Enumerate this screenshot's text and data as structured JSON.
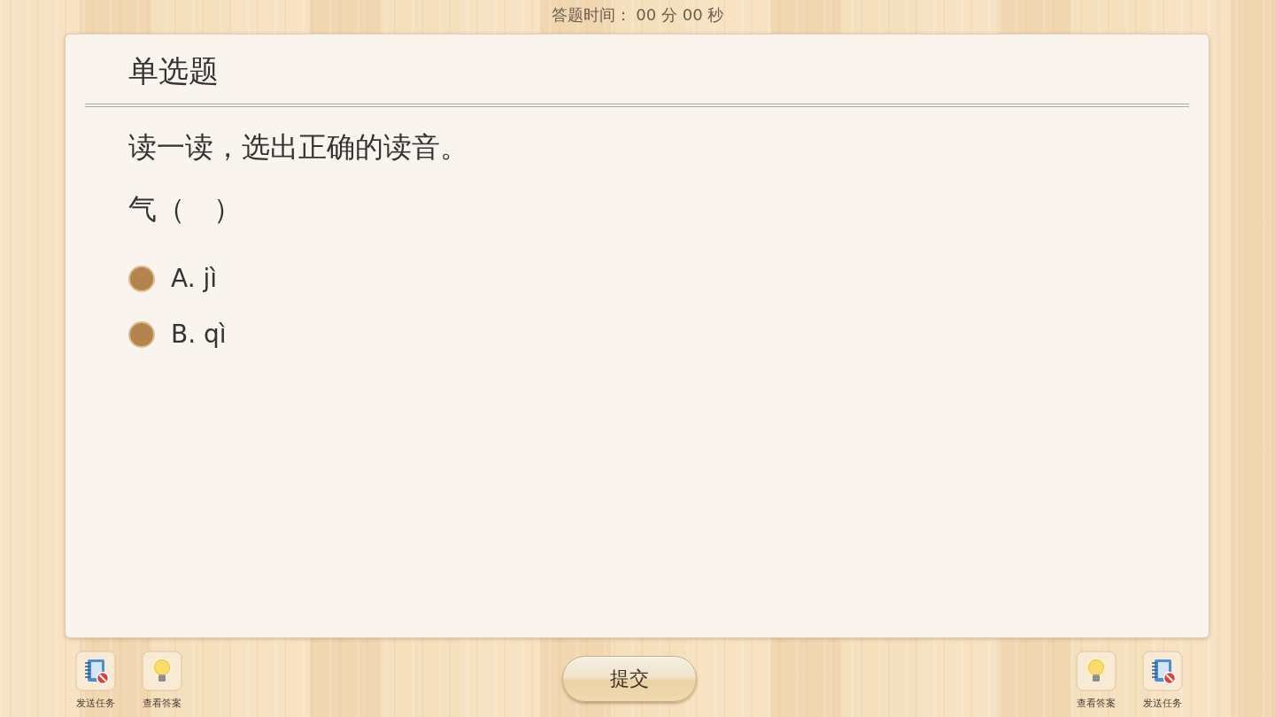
{
  "timer": {
    "label": "答题时间：",
    "value": "00 分 00 秒"
  },
  "question": {
    "type_title": "单选题",
    "prompt": "读一读，选出正确的读音。",
    "stem": "气（　）",
    "options": [
      {
        "label": "A. jì",
        "selected": false
      },
      {
        "label": "B. qì",
        "selected": false
      }
    ]
  },
  "toolbar_left": [
    {
      "kind": "send",
      "label": "发送任务"
    },
    {
      "kind": "answer",
      "label": "查看答案"
    }
  ],
  "submit_button": {
    "label": "提交"
  },
  "toolbar_right": [
    {
      "kind": "answer",
      "label": "查看答案"
    },
    {
      "kind": "send",
      "label": "发送任务"
    }
  ]
}
